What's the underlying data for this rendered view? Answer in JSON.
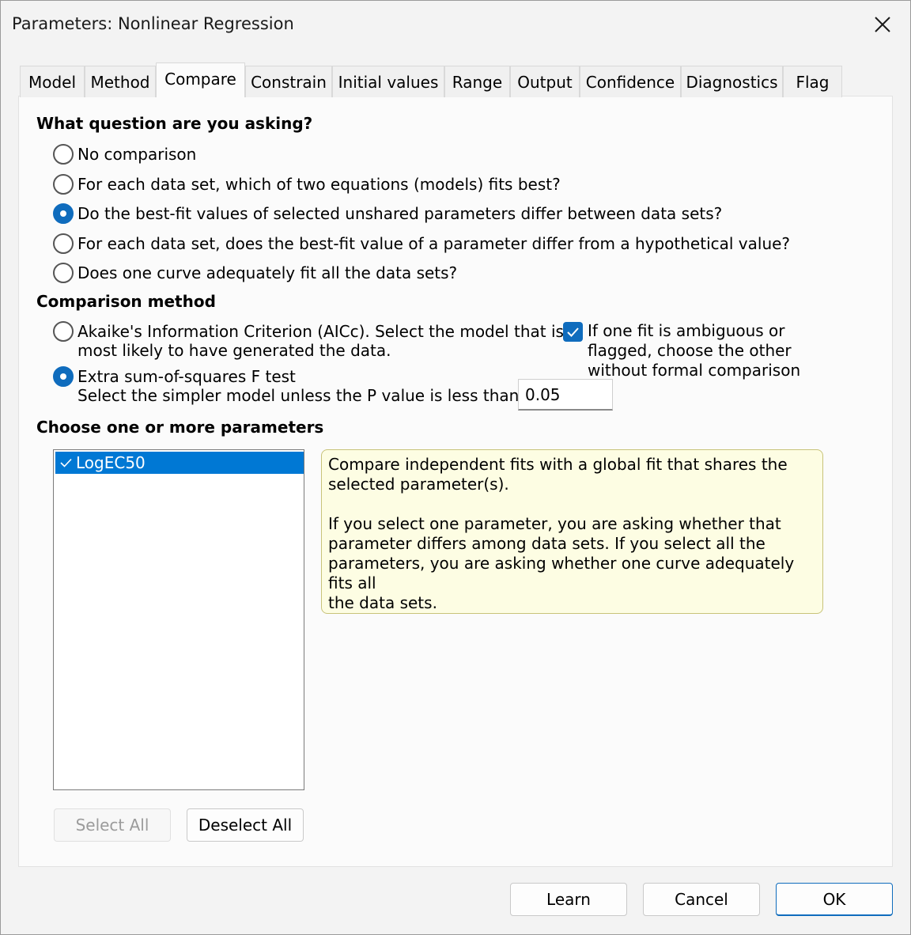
{
  "window": {
    "title": "Parameters: Nonlinear Regression"
  },
  "tabs": [
    {
      "label": "Model"
    },
    {
      "label": "Method"
    },
    {
      "label": "Compare"
    },
    {
      "label": "Constrain"
    },
    {
      "label": "Initial values"
    },
    {
      "label": "Range"
    },
    {
      "label": "Output"
    },
    {
      "label": "Confidence"
    },
    {
      "label": "Diagnostics"
    },
    {
      "label": "Flag"
    }
  ],
  "active_tab": "Compare",
  "question": {
    "title": "What question are you asking?",
    "options": [
      {
        "label": "No comparison",
        "selected": false
      },
      {
        "label": "For each data set, which of two equations (models) fits best?",
        "selected": false
      },
      {
        "label": "Do the best-fit values of selected unshared parameters differ between data sets?",
        "selected": true
      },
      {
        "label": "For each data set, does the best-fit value of a parameter differ from a hypothetical value?",
        "selected": false
      },
      {
        "label": "Does one curve adequately fit all the data sets?",
        "selected": false
      }
    ]
  },
  "method": {
    "title": "Comparison method",
    "aicc": {
      "line1": "Akaike's Information Criterion (AICc). Select the model that is",
      "line2": "most likely to have generated the data.",
      "selected": false
    },
    "ftest": {
      "line1": "Extra sum-of-squares F test",
      "line2": "Select the simpler model unless the P value is less than",
      "selected": true
    },
    "p_value": "0.05",
    "ambiguous_checkbox": {
      "line1": "If one fit is ambiguous or",
      "line2": "flagged, choose the other",
      "line3": "without formal comparison",
      "checked": true
    }
  },
  "parameters": {
    "title": "Choose one or more parameters",
    "items": [
      {
        "label": "LogEC50",
        "checked": true
      }
    ],
    "select_all_label": "Select All",
    "deselect_all_label": "Deselect All"
  },
  "info": {
    "para1": "Compare independent fits with a global fit that shares the\nselected parameter(s).",
    "para2": "If you select one parameter, you are asking whether that\nparameter differs among data sets. If you select all the\nparameters, you are asking whether one curve adequately fits all\nthe data sets."
  },
  "footer": {
    "learn_label": "Learn",
    "cancel_label": "Cancel",
    "ok_label": "OK"
  },
  "colors": {
    "accent": "#0f6cbd",
    "selection": "#0078d4",
    "info_bg": "#fdfde3"
  }
}
